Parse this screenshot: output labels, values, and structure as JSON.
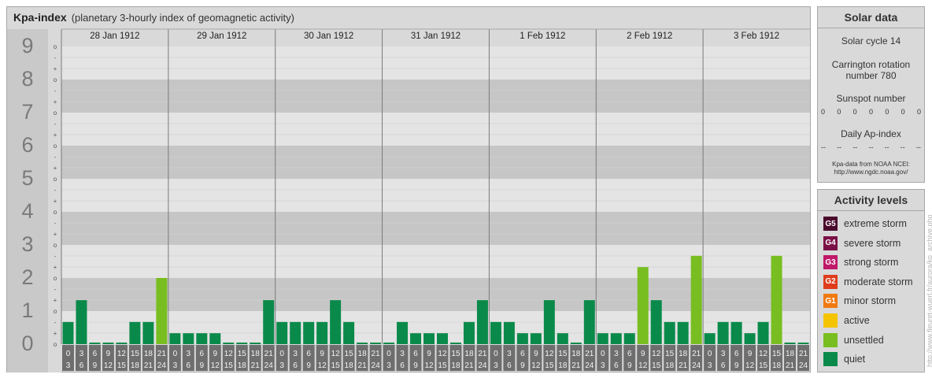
{
  "header": {
    "title": "Kpa-index",
    "subtitle": "(planetary 3-hourly index of geomagnetic activity)"
  },
  "chart_data": {
    "type": "bar",
    "ylim": [
      0,
      9
    ],
    "y_tick_labels": [
      "0",
      "1",
      "2",
      "3",
      "4",
      "5",
      "6",
      "7",
      "8",
      "9"
    ],
    "sub_tick_labels": [
      "o",
      "+",
      "-"
    ],
    "days": [
      "28 Jan 1912",
      "29 Jan 1912",
      "30 Jan 1912",
      "31 Jan 1912",
      "1 Feb 1912",
      "2 Feb 1912",
      "3 Feb 1912"
    ],
    "interval_labels": [
      [
        "0",
        "3"
      ],
      [
        "3",
        "6"
      ],
      [
        "6",
        "9"
      ],
      [
        "9",
        "12"
      ],
      [
        "12",
        "15"
      ],
      [
        "15",
        "18"
      ],
      [
        "18",
        "21"
      ],
      [
        "21",
        "24"
      ]
    ],
    "series": [
      {
        "values": [
          0.67,
          1.33,
          0,
          0,
          0,
          0.67,
          0.67,
          2.0,
          0.33,
          0.33,
          0.33,
          0.33,
          0,
          0,
          0,
          1.33,
          0.67,
          0.67,
          0.67,
          0.67,
          1.33,
          0.67,
          0,
          0,
          0,
          0.67,
          0.33,
          0.33,
          0.33,
          0,
          0.67,
          1.33,
          0.67,
          0.67,
          0.33,
          0.33,
          1.33,
          0.33,
          0,
          1.33,
          0.33,
          0.33,
          0.33,
          2.33,
          1.33,
          0.67,
          0.67,
          2.67,
          0.33,
          0.67,
          0.67,
          0.33,
          0.67,
          2.67,
          0,
          0
        ]
      }
    ],
    "thresholds": {
      "unsettled": 2.0
    },
    "colors": {
      "quiet": "#0a8a4a",
      "unsettled": "#78be20"
    },
    "grid": true,
    "legend": "none"
  },
  "solar": {
    "title": "Solar data",
    "cycle": "Solar cycle 14",
    "carrington": "Carrington rotation number 780",
    "sunspot_title": "Sunspot number",
    "sunspot_values": [
      "0",
      "0",
      "0",
      "0",
      "0",
      "0",
      "0"
    ],
    "ap_title": "Daily Ap-index",
    "ap_values": [
      "--",
      "--",
      "--",
      "--",
      "--",
      "--",
      "--"
    ],
    "source_line1": "Kpa-data from NOAA NCEI:",
    "source_line2": "http://www.ngdc.noaa.gov/"
  },
  "levels": {
    "title": "Activity levels",
    "items": [
      {
        "code": "G5",
        "label": "extreme storm",
        "color": "#4a0a2c"
      },
      {
        "code": "G4",
        "label": "severe storm",
        "color": "#7a1046"
      },
      {
        "code": "G3",
        "label": "strong storm",
        "color": "#c0186a"
      },
      {
        "code": "G2",
        "label": "moderate storm",
        "color": "#e03c1c"
      },
      {
        "code": "G1",
        "label": "minor storm",
        "color": "#f07a12"
      },
      {
        "code": "",
        "label": "active",
        "color": "#f5c400"
      },
      {
        "code": "",
        "label": "unsettled",
        "color": "#78be20"
      },
      {
        "code": "",
        "label": "quiet",
        "color": "#0a8a4a"
      }
    ]
  },
  "watermark": "http://www.fleuret-wuerl.fr/aurora/kp_archive.php"
}
